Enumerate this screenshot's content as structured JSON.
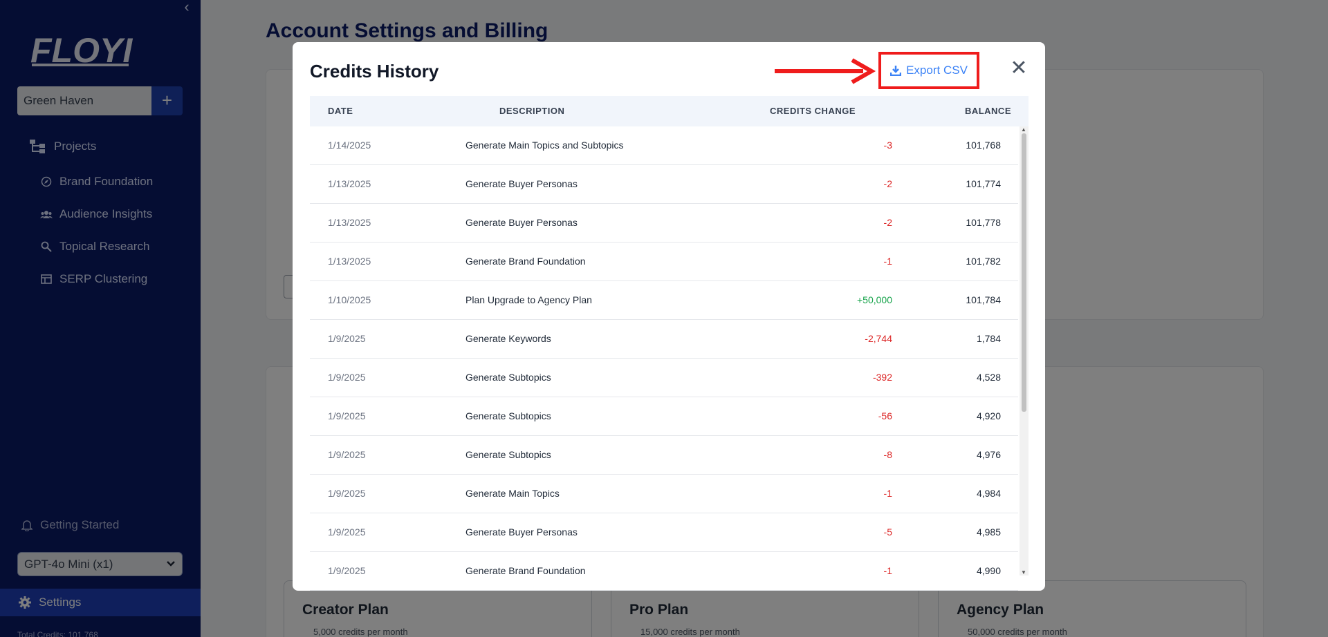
{
  "sidebar": {
    "logo_text": "FLOYI",
    "project": "Green Haven",
    "add_label": "+",
    "nav": {
      "projects": "Projects",
      "items": [
        "Brand Foundation",
        "Audience Insights",
        "Topical Research",
        "SERP Clustering"
      ]
    },
    "getting_started": "Getting Started",
    "model": "GPT-4o Mini (x1)",
    "settings": "Settings",
    "total_credits": "Total Credits: 101,768",
    "colors": {
      "bg": "#0b1a66",
      "active": "#1f3fb8"
    }
  },
  "page": {
    "title": "Account Settings and Billing",
    "plans": [
      {
        "name": "Creator Plan",
        "feature": "5,000 credits per month"
      },
      {
        "name": "Pro Plan",
        "feature": "15,000 credits per month"
      },
      {
        "name": "Agency Plan",
        "feature": "50,000 credits per month"
      }
    ]
  },
  "modal": {
    "title": "Credits History",
    "export_label": "Export CSV",
    "close_label": "✕",
    "columns": [
      "DATE",
      "DESCRIPTION",
      "CREDITS CHANGE",
      "BALANCE"
    ],
    "rows": [
      {
        "date": "1/14/2025",
        "description": "Generate Main Topics and Subtopics",
        "change": "-3",
        "balance": "101,768"
      },
      {
        "date": "1/13/2025",
        "description": "Generate Buyer Personas",
        "change": "-2",
        "balance": "101,774"
      },
      {
        "date": "1/13/2025",
        "description": "Generate Buyer Personas",
        "change": "-2",
        "balance": "101,778"
      },
      {
        "date": "1/13/2025",
        "description": "Generate Brand Foundation",
        "change": "-1",
        "balance": "101,782"
      },
      {
        "date": "1/10/2025",
        "description": "Plan Upgrade to Agency Plan",
        "change": "+50,000",
        "balance": "101,784"
      },
      {
        "date": "1/9/2025",
        "description": "Generate Keywords",
        "change": "-2,744",
        "balance": "1,784"
      },
      {
        "date": "1/9/2025",
        "description": "Generate Subtopics",
        "change": "-392",
        "balance": "4,528"
      },
      {
        "date": "1/9/2025",
        "description": "Generate Subtopics",
        "change": "-56",
        "balance": "4,920"
      },
      {
        "date": "1/9/2025",
        "description": "Generate Subtopics",
        "change": "-8",
        "balance": "4,976"
      },
      {
        "date": "1/9/2025",
        "description": "Generate Main Topics",
        "change": "-1",
        "balance": "4,984"
      },
      {
        "date": "1/9/2025",
        "description": "Generate Buyer Personas",
        "change": "-5",
        "balance": "4,985"
      },
      {
        "date": "1/9/2025",
        "description": "Generate Brand Foundation",
        "change": "-1",
        "balance": "4,990"
      }
    ],
    "colors": {
      "negative": "#dc2626",
      "positive": "#16a34a",
      "export": "#3b82f6",
      "highlight": "#ef1c1c"
    }
  }
}
